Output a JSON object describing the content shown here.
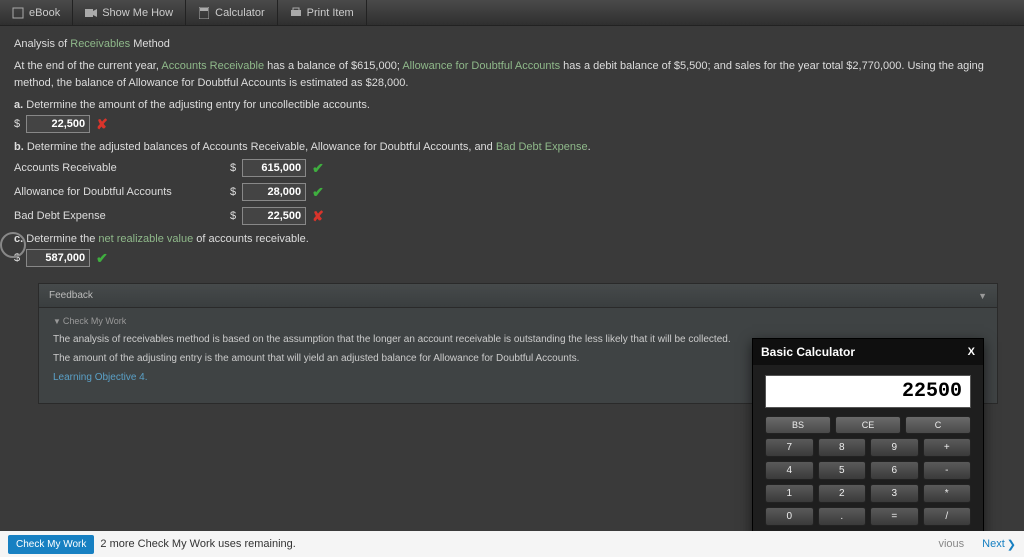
{
  "topbar": {
    "ebook": "eBook",
    "show_me_how": "Show Me How",
    "calculator": "Calculator",
    "print_item": "Print Item"
  },
  "title": {
    "prefix": "Analysis of ",
    "hl": "Receivables",
    "suffix": " Method"
  },
  "paragraph": {
    "p1": "At the end of the current year, ",
    "hl1": "Accounts Receivable",
    "p2": " has a balance of $615,000; ",
    "hl2": "Allowance for Doubtful Accounts",
    "p3": " has a debit balance of $5,500; and sales for the year total $2,770,000. Using the aging method, the balance of Allowance for Doubtful Accounts is estimated as $28,000."
  },
  "qa": {
    "label": "a.",
    "text": "Determine the amount of the adjusting entry for uncollectible accounts.",
    "value": "22,500",
    "mark": "✘"
  },
  "qb": {
    "label": "b.",
    "text_pre": "Determine the adjusted balances of Accounts Receivable, Allowance for Doubtful Accounts, and ",
    "hl": "Bad Debt Expense",
    "rows": [
      {
        "label": "Accounts Receivable",
        "value": "615,000",
        "mark": "✔"
      },
      {
        "label": "Allowance for Doubtful Accounts",
        "value": "28,000",
        "mark": "✔"
      },
      {
        "label": "Bad Debt Expense",
        "value": "22,500",
        "mark": "✘"
      }
    ]
  },
  "qc": {
    "label": "c.",
    "text_pre": "Determine the ",
    "hl": "net realizable value",
    "text_post": " of accounts receivable.",
    "value": "587,000",
    "mark": "✔"
  },
  "feedback": {
    "title": "Feedback",
    "cmw": "Check My Work",
    "line1": "The analysis of receivables method is based on the assumption that the longer an account receivable is outstanding the less likely that it will be collected.",
    "line2": "The amount of the adjusting entry is the amount that will yield an adjusted balance for Allowance for Doubtful Accounts.",
    "lo": "Learning Objective 4."
  },
  "calculator_widget": {
    "title": "Basic Calculator",
    "close": "X",
    "display": "22500",
    "top_row": [
      "BS",
      "CE",
      "C"
    ],
    "rows": [
      [
        "7",
        "8",
        "9",
        "+"
      ],
      [
        "4",
        "5",
        "6",
        "-"
      ],
      [
        "1",
        "2",
        "3",
        "*"
      ],
      [
        "0",
        ".",
        "=",
        "/"
      ]
    ]
  },
  "footer": {
    "cmw_btn": "Check My Work",
    "remaining": "2 more Check My Work uses remaining.",
    "prev": "vious",
    "next": "Next"
  }
}
